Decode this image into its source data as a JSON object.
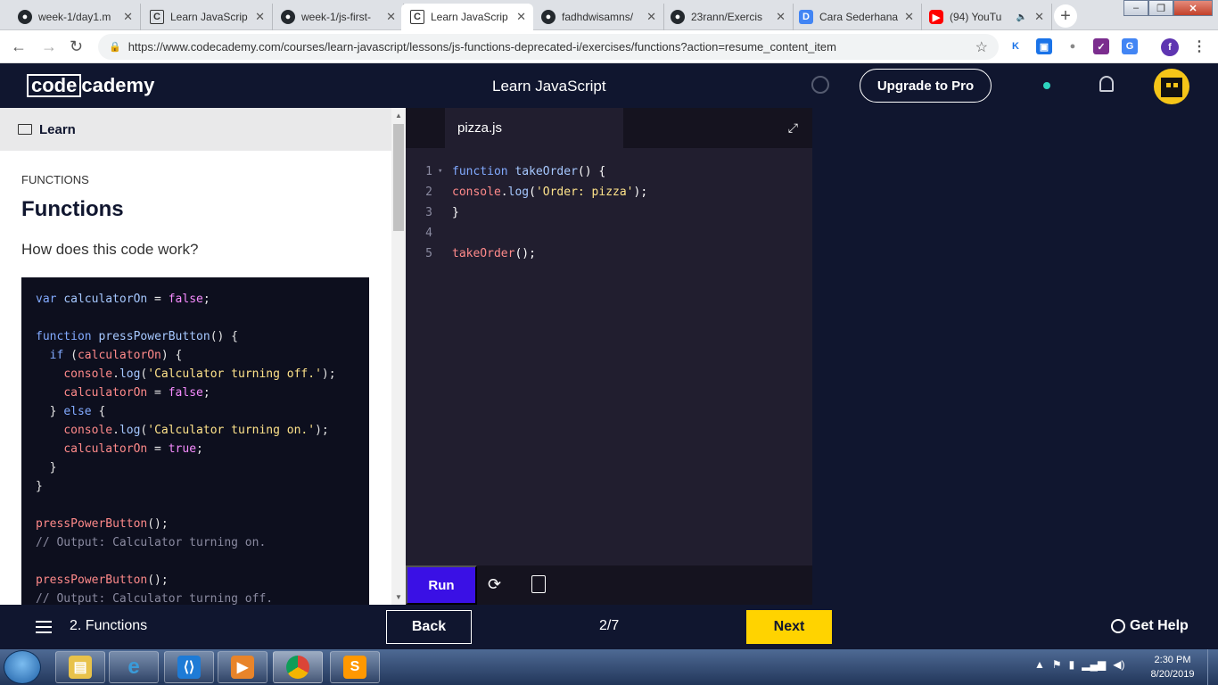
{
  "browser": {
    "tabs": [
      {
        "title": "week-1/day1.m",
        "icon": "github-icon"
      },
      {
        "title": "Learn JavaScrip",
        "icon": "codecademy-icon"
      },
      {
        "title": "week-1/js-first-",
        "icon": "github-icon"
      },
      {
        "title": "Learn JavaScrip",
        "icon": "codecademy-icon"
      },
      {
        "title": "fadhdwisamns/",
        "icon": "github-icon"
      },
      {
        "title": "23rann/Exercis",
        "icon": "github-icon"
      },
      {
        "title": "Cara Sederhana",
        "icon": "google-docs-icon"
      },
      {
        "title": "(94) YouTu",
        "icon": "youtube-icon"
      }
    ],
    "url": "https://www.codecademy.com/courses/learn-javascript/lessons/js-functions-deprecated-i/exercises/functions?action=resume_content_item",
    "profile_initial": "f"
  },
  "header": {
    "logo_part1": "code",
    "logo_part2": "cademy",
    "course_title": "Learn JavaScript",
    "upgrade_label": "Upgrade to Pro"
  },
  "lesson": {
    "learn_label": "Learn",
    "section": "FUNCTIONS",
    "title": "Functions",
    "question": "How does this code work?"
  },
  "editor": {
    "filename": "pizza.js",
    "run_label": "Run"
  },
  "footer": {
    "lesson_label": "2. Functions",
    "back_label": "Back",
    "progress": "2/7",
    "next_label": "Next",
    "help_label": "Get Help"
  },
  "taskbar": {
    "time": "2:30 PM",
    "date": "8/20/2019"
  },
  "colors": {
    "accent": "#3a10e5",
    "next": "#ffd300",
    "nav": "#10162f"
  }
}
